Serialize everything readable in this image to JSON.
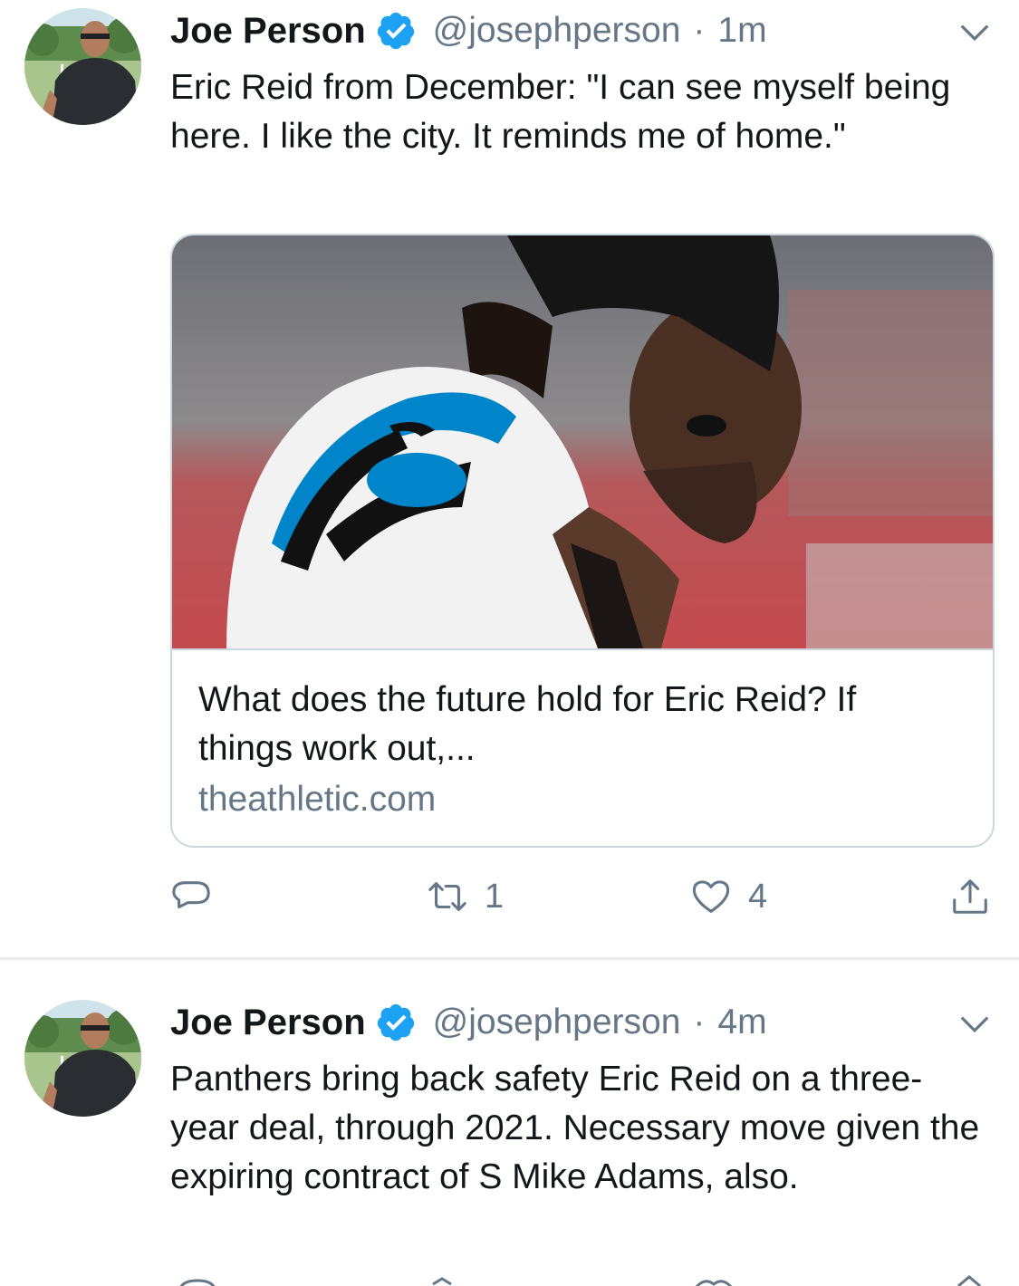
{
  "tweets": [
    {
      "author": {
        "display_name": "Joe Person",
        "handle": "@josephperson",
        "verified": true
      },
      "separator": "·",
      "time": "1m",
      "text": "Eric Reid from December: \"I can see myself being here. I like the city. It reminds me of home.\"",
      "card": {
        "title": "What does the future hold for Eric Reid? If things work out,...",
        "domain": "theathletic.com"
      },
      "actions": {
        "reply_icon": "reply-icon",
        "retweet_icon": "retweet-icon",
        "retweet_count": "1",
        "like_icon": "heart-icon",
        "like_count": "4",
        "share_icon": "share-icon"
      }
    },
    {
      "author": {
        "display_name": "Joe Person",
        "handle": "@josephperson",
        "verified": true
      },
      "separator": "·",
      "time": "4m",
      "text": "Panthers bring back safety Eric Reid on a three-year deal, through 2021. Necessary move given the expiring contract of S Mike Adams, also."
    }
  ],
  "colors": {
    "text_primary": "#14171a",
    "text_secondary": "#657786",
    "verified_blue": "#1da1f2",
    "border": "#ccd6dd",
    "divider": "#e6ecf0",
    "panthers_blue": "#0085ca"
  }
}
